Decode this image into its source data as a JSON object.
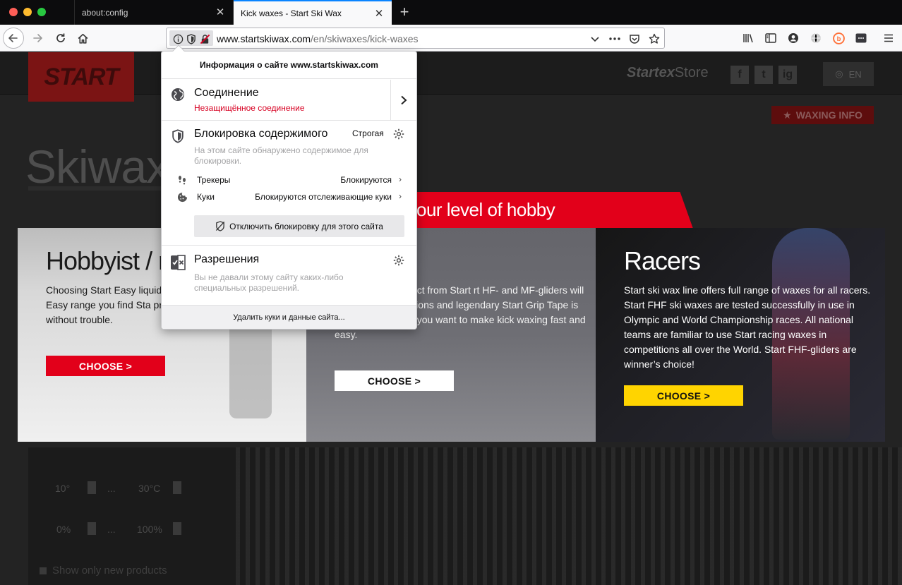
{
  "tabs": [
    {
      "title": "about:config",
      "active": false
    },
    {
      "title": "Kick waxes - Start Ski Wax",
      "active": true
    }
  ],
  "urlbar": {
    "domain": "www.startskiwax.com",
    "path": "/en/skiwaxes/kick-waxes"
  },
  "site": {
    "logo": "START",
    "startex": {
      "brand": "Startex",
      "store": "Store"
    },
    "social": [
      "f",
      "t",
      "ig"
    ],
    "lang": "EN",
    "waxing_info": "WAXING INFO",
    "page_title": "Skiwaxes",
    "banner": "our level of hobby",
    "cards": [
      {
        "title": "Hobbyist / r",
        "text": "Choosing Start Easy liquid prepare tour skis easy and the Easy range you find Sta prepare your skin skis fast and without trouble.",
        "button": "CHOOSE >"
      },
      {
        "title": "kiers",
        "text": "will find right product from Start rt HF- and MF-gliders will give you ow conditions and legendary Start Grip Tape is good choice when you want to make kick waxing fast and easy.",
        "button": "CHOOSE >"
      },
      {
        "title": "Racers",
        "text": "Start ski wax line offers full range of waxes for all racers. Start FHF ski waxes are tested successfully in use in Olympic and World Championship races. All national teams are familiar to use Start racing waxes in competitions all over the World. Start FHF-gliders are winner’s choice!",
        "button": "CHOOSE >"
      }
    ],
    "filters": {
      "temp_from": "10°",
      "temp_to": "30°C",
      "hum_from": "0%",
      "hum_to": "100%",
      "separator": "...",
      "show_new": "Show only new products"
    }
  },
  "popup": {
    "header": "Информация о сайте www.startskiwax.com",
    "connection": {
      "title": "Соединение",
      "status": "Незащищённое соединение"
    },
    "blocking": {
      "title": "Блокировка содержимого",
      "mode": "Строгая",
      "description": "На этом сайте обнаружено содержимое для блокировки.",
      "rows": [
        {
          "label": "Трекеры",
          "value": "Блокируются"
        },
        {
          "label": "Куки",
          "value": "Блокируются отслеживающие куки"
        }
      ],
      "disable_button": "Отключить блокировку для этого сайта"
    },
    "permissions": {
      "title": "Разрешения",
      "description": "Вы не давали этому сайту каких-либо специальных разрешений."
    },
    "footer": "Удалить куки и данные сайта..."
  },
  "colors": {
    "accent": "#0a84ff",
    "insecure": "#d70022",
    "brand_red": "#e2001a",
    "brand_yellow": "#ffd400"
  }
}
